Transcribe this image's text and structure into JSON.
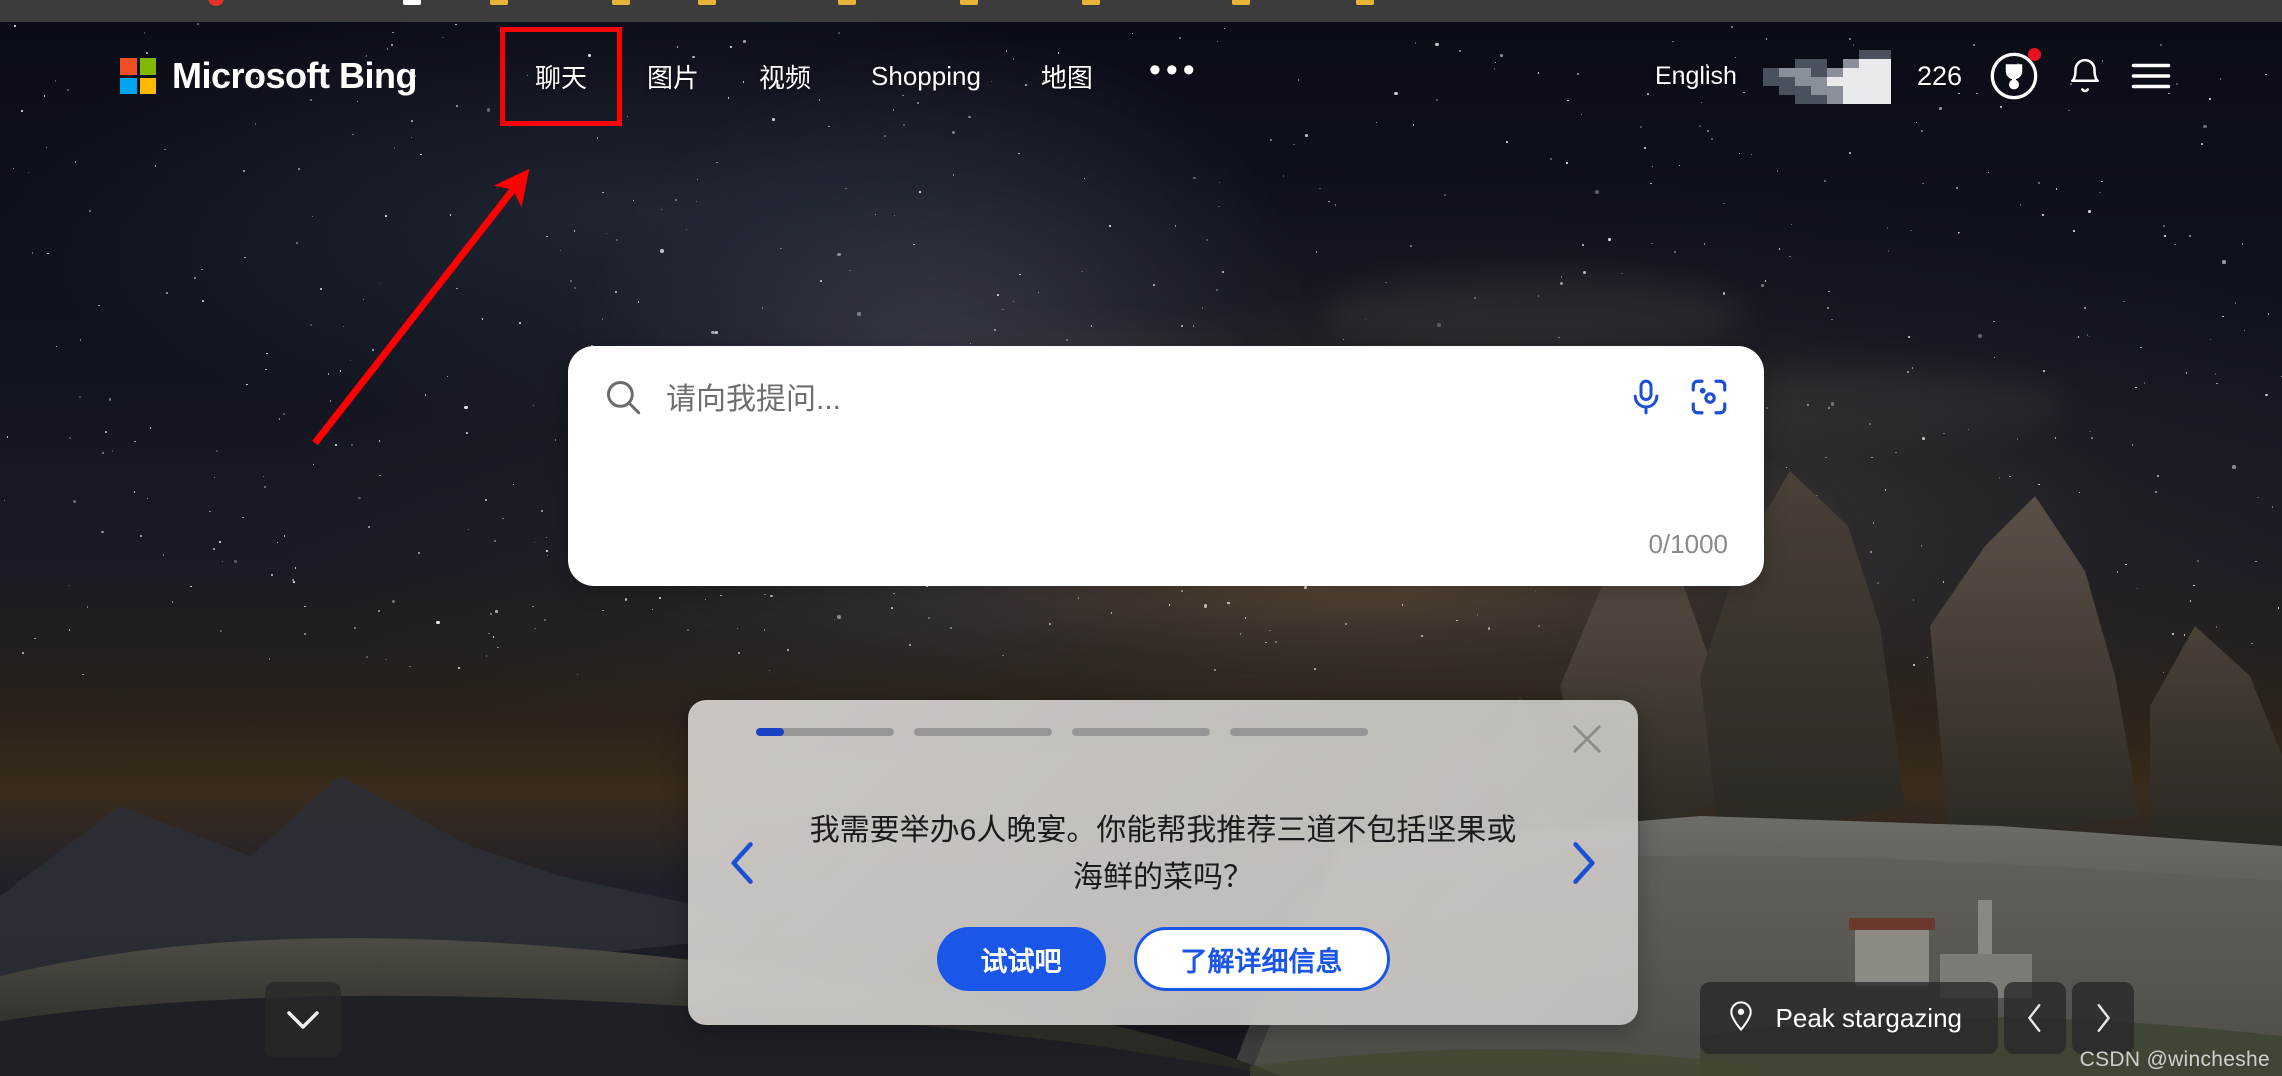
{
  "browser": {
    "bookmark_bar_visible": true
  },
  "header": {
    "brand": "Microsoft Bing",
    "logo_icon": "microsoft-logo-icon",
    "nav": [
      {
        "label": "聊天",
        "highlighted": true
      },
      {
        "label": "图片",
        "highlighted": false
      },
      {
        "label": "视频",
        "highlighted": false
      },
      {
        "label": "Shopping",
        "highlighted": false
      },
      {
        "label": "地图",
        "highlighted": false
      }
    ],
    "more_label": "•••",
    "language": "English",
    "account_name_redacted": "",
    "rewards_count": "226",
    "rewards_icon": "rewards-medal-icon",
    "notification_icon": "bell-icon",
    "menu_icon": "hamburger-menu-icon",
    "has_reward_notification_dot": true
  },
  "search": {
    "placeholder": "请向我提问...",
    "value": "",
    "counter": "0/1000",
    "search_icon": "search-icon",
    "mic_icon": "microphone-icon",
    "visual_search_icon": "visual-search-camera-icon"
  },
  "carousel_card": {
    "message": "我需要举办6人晚宴。你能帮我推荐三道不包括坚果或海鲜的菜吗？",
    "primary_button": "试试吧",
    "secondary_button": "了解详细信息",
    "close_icon": "close-icon",
    "prev_icon": "chevron-left-icon",
    "next_icon": "chevron-right-icon",
    "progress": {
      "segments": 4,
      "active_index": 0,
      "active_fill_percent": 20
    }
  },
  "bottom": {
    "scroll_down_icon": "chevron-down-icon",
    "image_location": "Peak stargazing",
    "location_pin_icon": "location-pin-icon",
    "prev_image_icon": "chevron-left-icon",
    "next_image_icon": "chevron-right-icon"
  },
  "watermark": "CSDN @wincheshe",
  "annotation": {
    "type": "red-arrow",
    "points_to": "聊天",
    "color": "#ff0000"
  },
  "colors": {
    "accent_blue": "#1a56e8",
    "progress_blue": "#1b41c4",
    "annotation_red": "#ff0000",
    "notification_red": "#e81123",
    "browser_bar": "#3c3c3c"
  }
}
